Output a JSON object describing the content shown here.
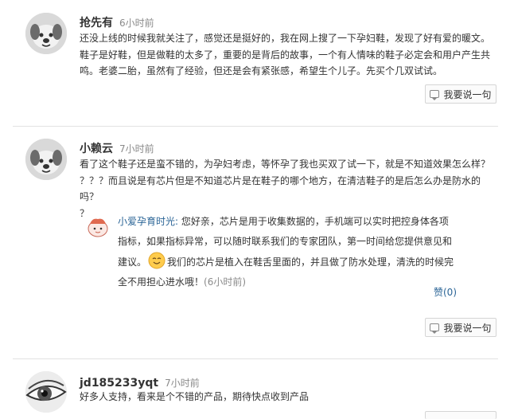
{
  "comments": [
    {
      "username": "抢先有",
      "time": "6小时前",
      "lines": [
        "还没上线的时候我就关注了，感觉还是挺好的，我在网上搜了一下孕妇鞋，发现了好有爱的暖文。",
        "鞋子是好鞋，但是做鞋的太多了，重要的是背后的故事，一个有人情味的鞋子必定会和用户产生共",
        "鸣。老婆二胎，虽然有了经验，但还是会有紧张感，希望生个儿子。先买个几双试试。"
      ],
      "reply_label": "我要说一句",
      "avatar_icon": "cartoon-dog-avatar"
    },
    {
      "username": "小赖云",
      "time": "7小时前",
      "lines": [
        "看了这个鞋子还是蛮不错的，为孕妇考虑，等怀孕了我也买双了试一下，就是不知道效果怎么样？",
        "？？？而且说是有芯片但是不知道芯片是在鞋子的哪个地方，在清洁鞋子的是后怎么办是防水的吗？",
        "？"
      ],
      "reply_label": "我要说一句",
      "avatar_icon": "cartoon-dog-avatar",
      "official_reply": {
        "name": "小爱孕育时光:",
        "line1": "您好亲，芯片是用于收集数据的，手机端可以实时把控身体各项",
        "line2": "指标，如果指标异常，可以随时联系我们的专家团队，第一时间给您提供意见和",
        "line3a": "建议。",
        "line3b": "我们的芯片是植入在鞋舌里面的，并且做了防水处理，清洗的时候完",
        "line4": "全不用担心进水哦！",
        "time": "(6小时前)",
        "like_label": "赞(0)",
        "avatar_icon": "mascot-avatar",
        "emoji_icon": "smile-emoji-icon"
      }
    },
    {
      "username": "jd185233yqt",
      "time": "7小时前",
      "lines": [
        "好多人支持，看来是个不错的产品，期待快点收到产品"
      ],
      "avatar_icon": "eye-photo-avatar"
    }
  ]
}
